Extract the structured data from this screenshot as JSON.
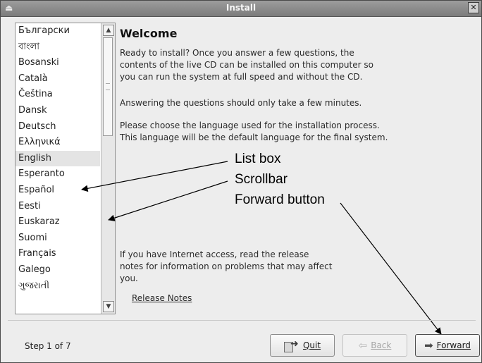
{
  "window": {
    "title": "Install",
    "close_glyph": "✕"
  },
  "languages": [
    {
      "label": "Български",
      "selected": false
    },
    {
      "label": "বাংলা",
      "selected": false
    },
    {
      "label": "Bosanski",
      "selected": false
    },
    {
      "label": "Català",
      "selected": false
    },
    {
      "label": "Čeština",
      "selected": false
    },
    {
      "label": "Dansk",
      "selected": false
    },
    {
      "label": "Deutsch",
      "selected": false
    },
    {
      "label": "Ελληνικά",
      "selected": false
    },
    {
      "label": "English",
      "selected": true
    },
    {
      "label": "Esperanto",
      "selected": false
    },
    {
      "label": "Español",
      "selected": false
    },
    {
      "label": "Eesti",
      "selected": false
    },
    {
      "label": "Euskaraz",
      "selected": false
    },
    {
      "label": "Suomi",
      "selected": false
    },
    {
      "label": "Français",
      "selected": false
    },
    {
      "label": "Galego",
      "selected": false
    },
    {
      "label": "ગુજરાતી",
      "selected": false
    }
  ],
  "content": {
    "heading": "Welcome",
    "intro": "Ready to install? Once you answer a few questions, the\ncontents of the live CD can be installed on this computer so\nyou can run the system at full speed and without the CD.",
    "questions": "Answering the questions should only take a few minutes.",
    "language_note": "Please choose the language used for the installation process.\nThis language will be the default language for the final system.",
    "internet_note": "If you have Internet access, read the release\nnotes for information on problems that may affect\nyou.",
    "release_link": "Release Notes"
  },
  "annotations": {
    "list_box": "List box",
    "scrollbar": "Scrollbar",
    "forward_button": "Forward button"
  },
  "footer": {
    "step": "Step 1 of 7",
    "quit": "Quit",
    "back": "Back",
    "forward": "Forward"
  }
}
